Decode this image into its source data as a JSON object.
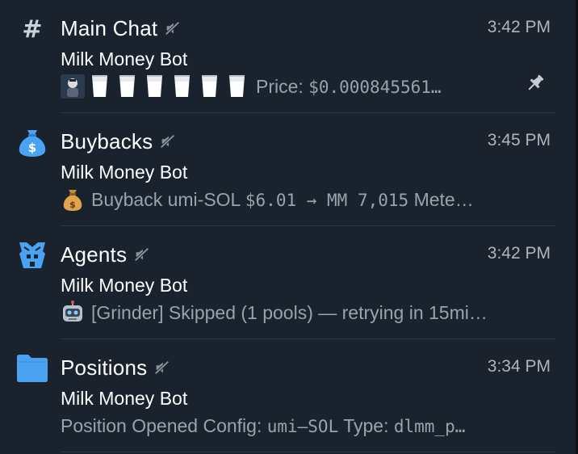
{
  "topics": [
    {
      "title": "Main Chat",
      "icon": "hash-icon",
      "time": "3:42 PM",
      "sender": "Milk Money Bot",
      "preview_prefix": "Price: ",
      "preview_mono": "$0.000845561…",
      "pinned": true,
      "muted": true
    },
    {
      "title": "Buybacks",
      "icon": "money-bag-icon",
      "time": "3:45 PM",
      "sender": "Milk Money Bot",
      "preview_prefix": "Buyback umi-SOL ",
      "preview_mono": "$6.01 → MM 7,015",
      "preview_suffix": " Mete…",
      "muted": true
    },
    {
      "title": "Agents",
      "icon": "transformer-icon",
      "time": "3:42 PM",
      "sender": "Milk Money Bot",
      "preview_text": "[Grinder] Skipped (1 pools) — retrying in 15mi…",
      "muted": true
    },
    {
      "title": "Positions",
      "icon": "folder-icon",
      "time": "3:34 PM",
      "sender": "Milk Money Bot",
      "preview_prefix": "Position Opened Config: ",
      "preview_mono": "umi–SOL",
      "preview_suffix": " Type: ",
      "preview_mono2": "dlmm_p…",
      "muted": true
    }
  ],
  "colors": {
    "background": "#1a222d",
    "title": "#ffffff",
    "muted_text": "#9aa3ad",
    "accent_blue": "#4aa3f0"
  }
}
